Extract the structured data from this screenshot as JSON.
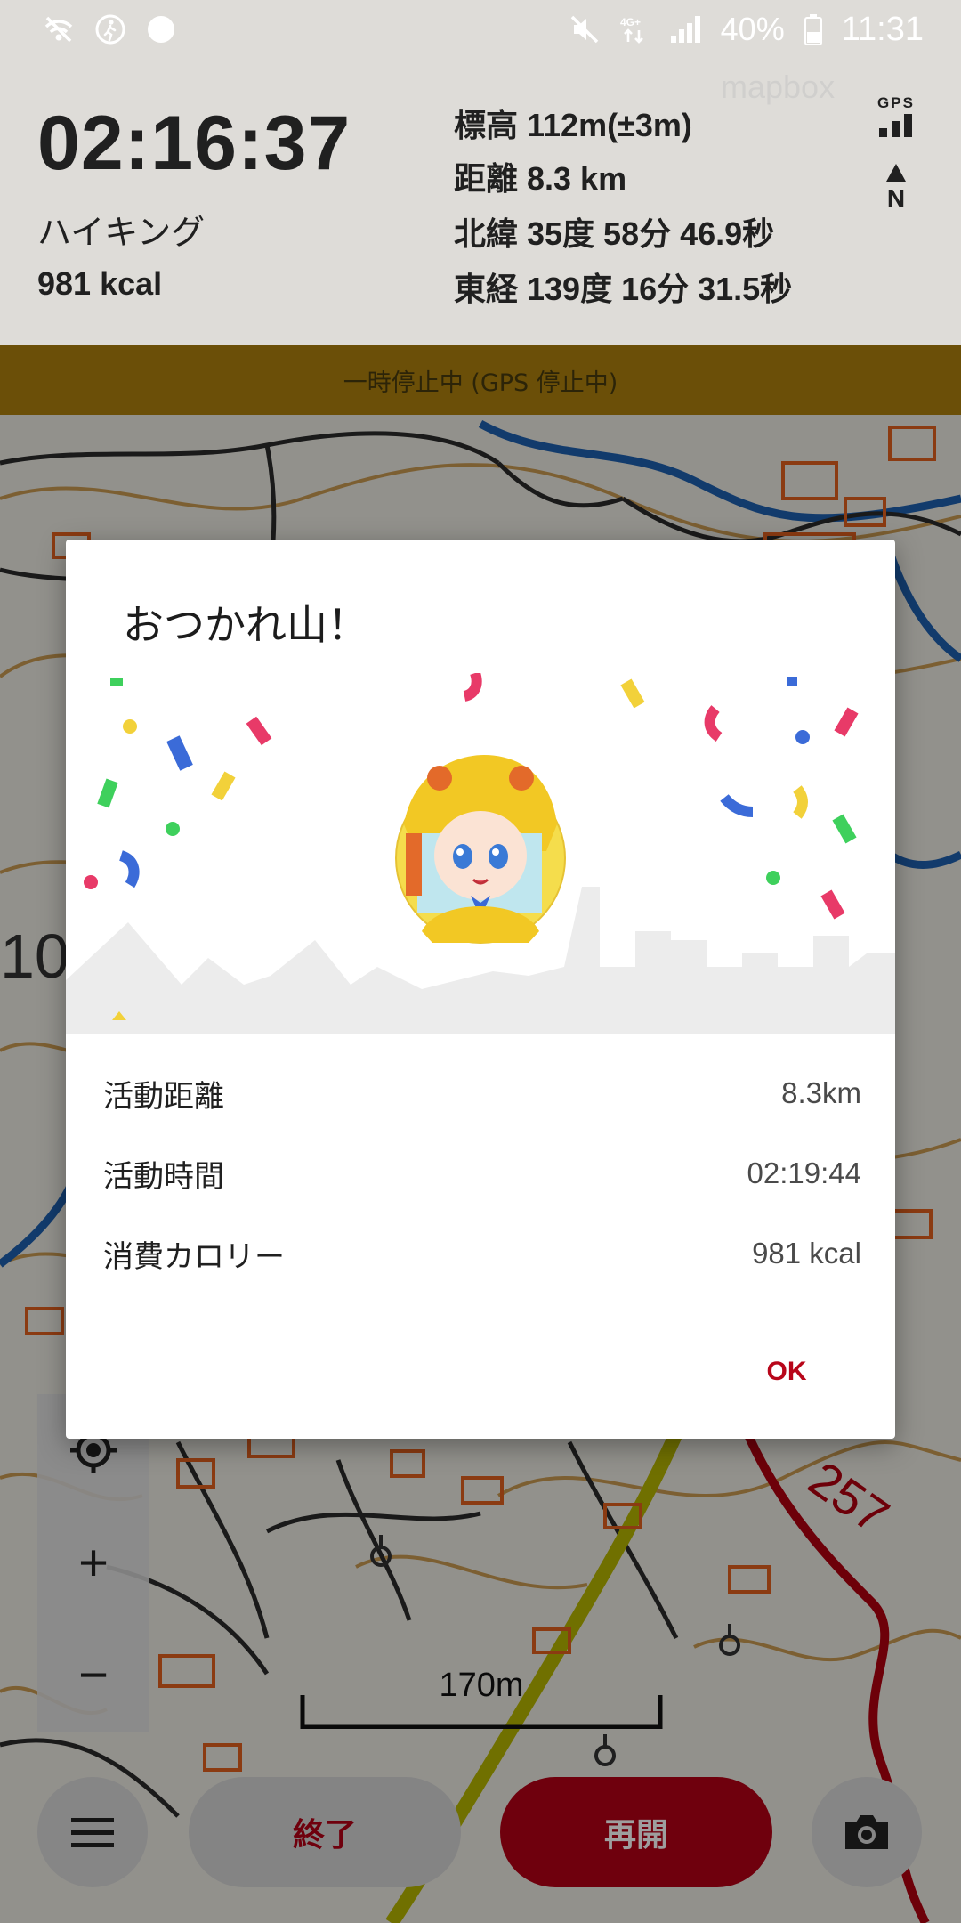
{
  "status_bar": {
    "battery": "40%",
    "time": "11:31",
    "network": "4G+",
    "left_icons": [
      "wifi-off-icon",
      "walking-icon",
      "dot-icon"
    ],
    "right_icons": [
      "mute-icon",
      "network-icon",
      "signal-icon",
      "battery-icon"
    ]
  },
  "header": {
    "elapsed": "02:16:37",
    "activity": "ハイキング",
    "kcal": "981 kcal",
    "elevation": "標高 112m(±3m)",
    "distance": "距離 8.3 km",
    "latitude": "北緯 35度 58分 46.9秒",
    "longitude": "東経 139度 16分 31.5秒",
    "gps_label": "GPS",
    "compass_label": "N"
  },
  "banner": {
    "text": "一時停止中 (GPS 停止中)"
  },
  "dialog": {
    "title": "おつかれ山！",
    "rows": [
      {
        "label": "活動距離",
        "value": "8.3km"
      },
      {
        "label": "活動時間",
        "value": "02:19:44"
      },
      {
        "label": "消費カロリー",
        "value": "981 kcal"
      }
    ],
    "ok_label": "OK"
  },
  "map": {
    "scale_label": "170m",
    "route_label": "257",
    "contour_label": "10",
    "watermark": "mapbox",
    "controls": [
      "locate-icon",
      "zoom-in-icon",
      "zoom-out-icon"
    ],
    "zoom_in_symbol": "+",
    "zoom_out_symbol": "−"
  },
  "bottom_bar": {
    "end_label": "終了",
    "resume_label": "再開"
  },
  "colors": {
    "accent": "#b30015",
    "banner": "#6b4f08",
    "ok": "#b8061a",
    "route": "#b00010",
    "river": "#1e5fae",
    "highway": "#c8c800"
  }
}
